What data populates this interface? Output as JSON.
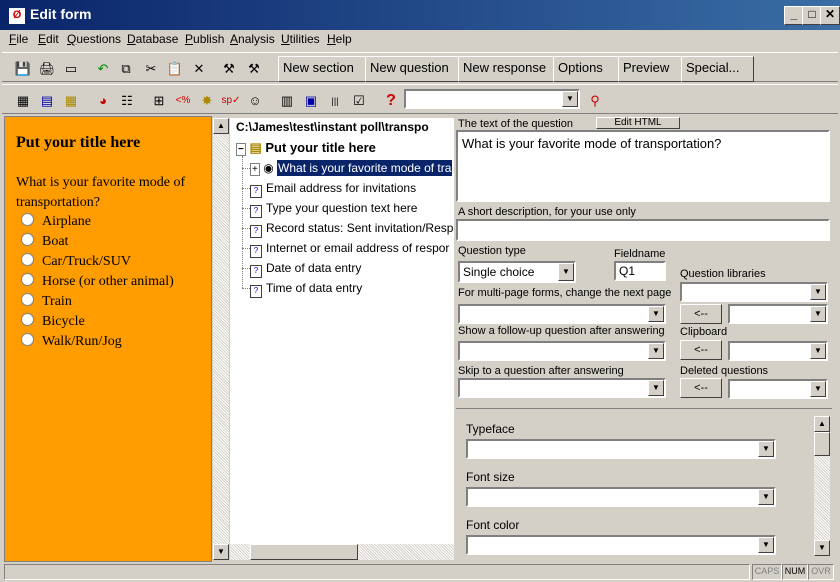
{
  "window": {
    "title": "Edit form"
  },
  "menu": [
    "File",
    "Edit",
    "Questions",
    "Database",
    "Publish",
    "Analysis",
    "Utilities",
    "Help"
  ],
  "toolbar1": {
    "icons": [
      "save-icon",
      "print-icon",
      "preview-form-icon",
      "undo-icon",
      "copy-icon",
      "cut-icon",
      "paste-icon",
      "delete-icon",
      "wand-icon",
      "wand-options-icon"
    ],
    "buttons": [
      "New section",
      "New question",
      "New response",
      "Options",
      "Preview",
      "Special..."
    ]
  },
  "toolbar2": {
    "icons": [
      "table-icon",
      "form-icon",
      "add-field-icon",
      "chart-pie-icon",
      "report-icon",
      "grid-icon",
      "percent-icon",
      "stats-icon",
      "spell-check-icon",
      "person-icon",
      "list-icon",
      "image-icon",
      "barcode-icon",
      "checklist-icon",
      "help-icon",
      "help-search-icon"
    ],
    "dropdown_value": ""
  },
  "form_preview": {
    "title": "Put your title here",
    "question": "What is your favorite mode of transportation?",
    "options": [
      "Airplane",
      "Boat",
      "Car/Truck/SUV",
      "Horse (or other animal)",
      "Train",
      "Bicycle",
      "Walk/Run/Jog"
    ]
  },
  "tree": {
    "path": "C:\\James\\test\\instant poll\\transpo",
    "root": "Put your title here",
    "items": [
      {
        "label": "What is your favorite mode of tra",
        "selected": true
      },
      {
        "label": "Email address for invitations"
      },
      {
        "label": "Type your question text here"
      },
      {
        "label": "Record status: Sent invitation/Resp"
      },
      {
        "label": "Internet or email address of respor"
      },
      {
        "label": "Date of data entry"
      },
      {
        "label": "Time of data entry"
      }
    ]
  },
  "editor": {
    "question_text_label": "The text of the question",
    "edit_html_label": "Edit HTML",
    "question_text": "What is your favorite mode of transportation?",
    "short_desc_label": "A short description, for your use only",
    "short_desc": "",
    "question_type_label": "Question type",
    "question_type": "Single choice",
    "fieldname_label": "Fieldname",
    "fieldname": "Q1",
    "next_page_label": "For multi-page forms, change the next page",
    "follow_up_label": "Show a follow-up question after answering",
    "skip_label": "Skip to a question after answering",
    "libraries_label": "Question libraries",
    "clipboard_label": "Clipboard",
    "deleted_label": "Deleted questions",
    "arrow_btn": "<--",
    "typeface_label": "Typeface",
    "font_size_label": "Font size",
    "font_color_label": "Font color"
  },
  "status": {
    "caps": "CAPS",
    "num": "NUM",
    "ovr": "OVR"
  },
  "colors": {
    "form_background": "#ff9c00",
    "selection": "#0a246a"
  }
}
